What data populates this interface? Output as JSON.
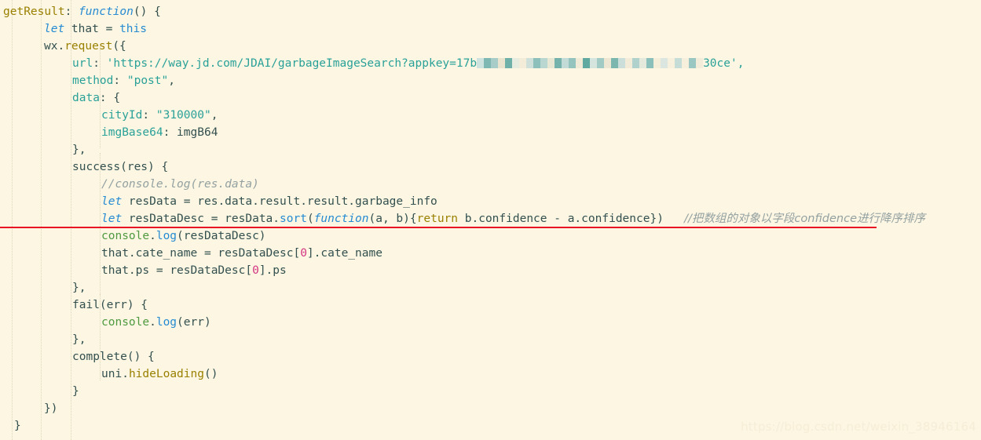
{
  "editor": {
    "theme_background": "#fdf6e3",
    "default_text_color": "#33504f",
    "indent_guide_color": "#ded4b9",
    "underline_color": "#e81123"
  },
  "watermark": {
    "text": "https://blog.csdn.net/weixin_38946164",
    "color": "#f6edd7"
  },
  "code": {
    "language": "javascript",
    "lines": [
      {
        "n": 1,
        "text": "getResult: function() {"
      },
      {
        "n": 2,
        "text": "    let that = this"
      },
      {
        "n": 3,
        "text": "    wx.request({"
      },
      {
        "n": 4,
        "text": "        url: 'https://way.jd.com/JDAI/garbageImageSearch?appkey=17b[REDACTED]30ce',"
      },
      {
        "n": 5,
        "text": "        method: \"post\","
      },
      {
        "n": 6,
        "text": "        data: {"
      },
      {
        "n": 7,
        "text": "            cityId: \"310000\","
      },
      {
        "n": 8,
        "text": "            imgBase64: imgB64"
      },
      {
        "n": 9,
        "text": "        },"
      },
      {
        "n": 10,
        "text": "        success(res) {"
      },
      {
        "n": 11,
        "text": "            //console.log(res.data)"
      },
      {
        "n": 12,
        "text": "            let resData = res.data.result.result.garbage_info"
      },
      {
        "n": 13,
        "text": "            let resDataDesc = resData.sort(function(a, b){return b.confidence - a.confidence})   //把数组的对象以字段confidence进行降序排序"
      },
      {
        "n": 14,
        "text": "            console.log(resDataDesc)"
      },
      {
        "n": 15,
        "text": "            that.cate_name = resDataDesc[0].cate_name"
      },
      {
        "n": 16,
        "text": "            that.ps = resDataDesc[0].ps"
      },
      {
        "n": 17,
        "text": "        },"
      },
      {
        "n": 18,
        "text": "        fail(err) {"
      },
      {
        "n": 19,
        "text": "            console.log(err)"
      },
      {
        "n": 20,
        "text": "        },"
      },
      {
        "n": 21,
        "text": "        complete() {"
      },
      {
        "n": 22,
        "text": "            uni.hideLoading()"
      },
      {
        "n": 23,
        "text": "        }"
      },
      {
        "n": 24,
        "text": "    })"
      },
      {
        "n": 25,
        "text": "}"
      }
    ],
    "tokens": {
      "l1": {
        "fn_name": "getResult",
        "colon": ":",
        "kw_function": "function",
        "parens": "() {"
      },
      "l2": {
        "kw_let": "let",
        "var": " that ",
        "eq": "= ",
        "kw_this": "this"
      },
      "l3": {
        "obj": "wx",
        "dot": ".",
        "method": "request",
        "open": "({"
      },
      "l4": {
        "key": "url",
        "colon": ": ",
        "str_head": "'https://way.jd.com/JDAI/garbageImageSearch?appkey=17b",
        "redacted": "[mosaic-blur]",
        "str_tail": "30ce',"
      },
      "l5": {
        "key": "method",
        "colon": ": ",
        "value": "\"post\"",
        "comma": ","
      },
      "l6": {
        "key": "data",
        "colon": ": ",
        "open": "{"
      },
      "l7": {
        "key": "cityId",
        "colon": ": ",
        "value": "\"310000\"",
        "comma": ","
      },
      "l8": {
        "key": "imgBase64",
        "colon": ": ",
        "value": "imgB64"
      },
      "l9": {
        "close": "},"
      },
      "l10": {
        "fn": "success",
        "args": "(res) {"
      },
      "l11": {
        "comment": "//console.log(res.data)"
      },
      "l12": {
        "kw_let": "let",
        "var": " resData ",
        "eq": "= ",
        "expr": "res.data.result.result.garbage_info"
      },
      "l13": {
        "kw_let": "let",
        "var": " resDataDesc ",
        "eq": "= ",
        "obj": "resData",
        "dot": ".",
        "sort": "sort",
        "open": "(",
        "kw_function": "function",
        "params": "(a, b)",
        "brace": "{",
        "kw_return": "return",
        "body": " b.confidence - a.confidence})",
        "spacer": "   ",
        "comment_cn": "//把数组的对象以字段confidence进行降序排序"
      },
      "l14": {
        "console": "console",
        "dot": ".",
        "log": "log",
        "args": "(resDataDesc)"
      },
      "l15": {
        "lhs": "that.cate_name ",
        "eq": "= ",
        "arr": "resDataDesc[",
        "index": "0",
        "tail": "].cate_name"
      },
      "l16": {
        "lhs": "that.ps ",
        "eq": "= ",
        "arr": "resDataDesc[",
        "index": "0",
        "tail": "].ps"
      },
      "l17": {
        "close": "},"
      },
      "l18": {
        "fn": "fail",
        "args": "(err) {"
      },
      "l19": {
        "console": "console",
        "dot": ".",
        "log": "log",
        "args": "(err)"
      },
      "l20": {
        "close": "},"
      },
      "l21": {
        "fn": "complete",
        "args": "() {"
      },
      "l22": {
        "obj": "uni",
        "dot": ".",
        "method": "hideLoading",
        "args": "()"
      },
      "l23": {
        "close": "}"
      },
      "l24": {
        "close": "})"
      },
      "l25": {
        "close": "}"
      }
    },
    "colors": {
      "keyword": "#268bd2",
      "property": "#2aa198",
      "string": "#2aa198",
      "function_name": "#9a8000",
      "number": "#d33682",
      "comment": "#93a1a1",
      "console_object": "#4f9a41",
      "plain": "#33504f"
    },
    "annotation": {
      "red_underline_on_line": 13,
      "note": "sort line underlined in red"
    }
  }
}
